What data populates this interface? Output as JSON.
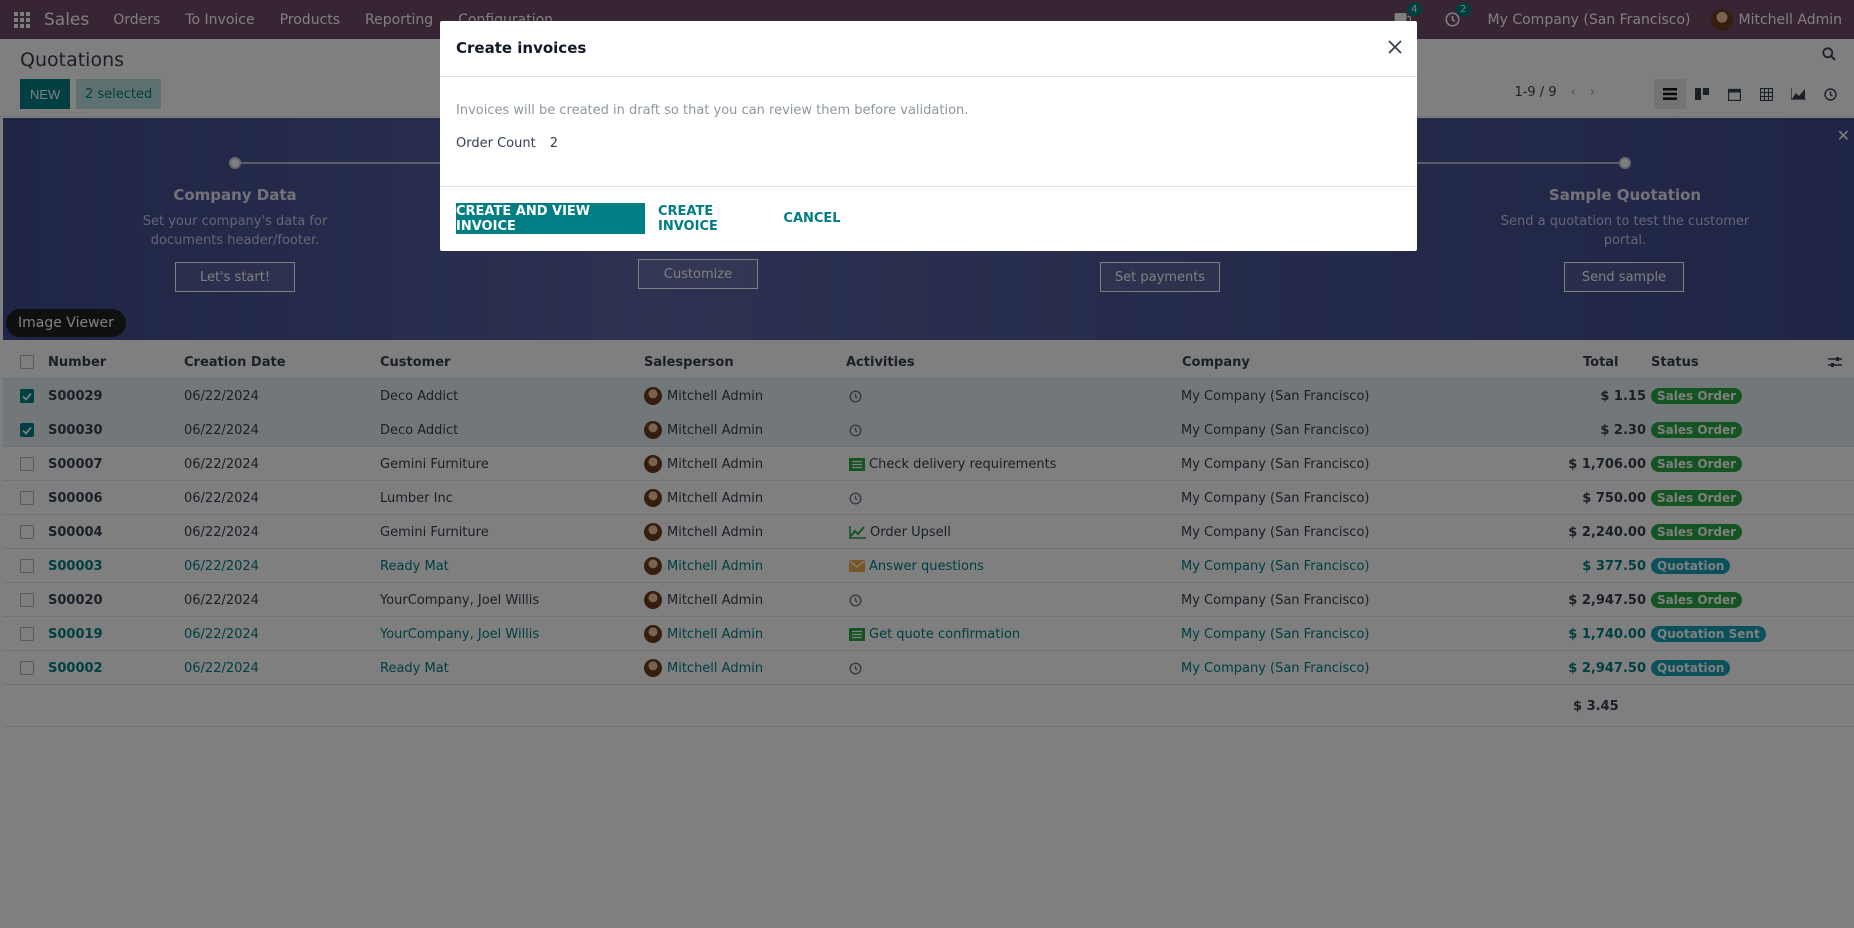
{
  "navbar": {
    "brand": "Sales",
    "menus": [
      "Orders",
      "To Invoice",
      "Products",
      "Reporting",
      "Configuration"
    ],
    "messages_count": "4",
    "activities_count": "2",
    "company": "My Company (San Francisco)",
    "user": "Mitchell Admin"
  },
  "control": {
    "title": "Quotations",
    "new_label": "NEW",
    "selected_label": "2 selected",
    "pager": "1-9 / 9"
  },
  "banner": {
    "steps": [
      {
        "title": "Company Data",
        "desc": "Set your company's data for documents header/footer.",
        "button": "Let's start!"
      },
      {
        "button": "Customize"
      },
      {
        "button": "Set payments"
      },
      {
        "title": "Sample Quotation",
        "desc": "Send a quotation to test the customer portal.",
        "button": "Send sample"
      }
    ],
    "tooltip": "Image Viewer"
  },
  "list": {
    "headers": {
      "number": "Number",
      "date": "Creation Date",
      "customer": "Customer",
      "salesperson": "Salesperson",
      "activities": "Activities",
      "company": "Company",
      "total": "Total",
      "status": "Status"
    },
    "rows": [
      {
        "number": "S00029",
        "date": "06/22/2024",
        "customer": "Deco Addict",
        "salesperson": "Mitchell Admin",
        "activity": "",
        "activity_icon": "clock-icon",
        "company": "My Company (San Francisco)",
        "total": "$ 1.15",
        "status": "Sales Order"
      },
      {
        "number": "S00030",
        "date": "06/22/2024",
        "customer": "Deco Addict",
        "salesperson": "Mitchell Admin",
        "activity": "",
        "activity_icon": "clock-icon",
        "company": "My Company (San Francisco)",
        "total": "$ 2.30",
        "status": "Sales Order"
      },
      {
        "number": "S00007",
        "date": "06/22/2024",
        "customer": "Gemini Furniture",
        "salesperson": "Mitchell Admin",
        "activity": "Check delivery requirements",
        "activity_icon": "list-icon",
        "company": "My Company (San Francisco)",
        "total": "$ 1,706.00",
        "status": "Sales Order"
      },
      {
        "number": "S00006",
        "date": "06/22/2024",
        "customer": "Lumber Inc",
        "salesperson": "Mitchell Admin",
        "activity": "",
        "activity_icon": "clock-icon",
        "company": "My Company (San Francisco)",
        "total": "$ 750.00",
        "status": "Sales Order"
      },
      {
        "number": "S00004",
        "date": "06/22/2024",
        "customer": "Gemini Furniture",
        "salesperson": "Mitchell Admin",
        "activity": "Order Upsell",
        "activity_icon": "chart-line-icon",
        "company": "My Company (San Francisco)",
        "total": "$ 2,240.00",
        "status": "Sales Order"
      },
      {
        "number": "S00003",
        "date": "06/22/2024",
        "customer": "Ready Mat",
        "salesperson": "Mitchell Admin",
        "activity": "Answer questions",
        "activity_icon": "envelope-icon",
        "company": "My Company (San Francisco)",
        "total": "$ 377.50",
        "status": "Quotation"
      },
      {
        "number": "S00020",
        "date": "06/22/2024",
        "customer": "YourCompany, Joel Willis",
        "salesperson": "Mitchell Admin",
        "activity": "",
        "activity_icon": "clock-icon",
        "company": "My Company (San Francisco)",
        "total": "$ 2,947.50",
        "status": "Sales Order"
      },
      {
        "number": "S00019",
        "date": "06/22/2024",
        "customer": "YourCompany, Joel Willis",
        "salesperson": "Mitchell Admin",
        "activity": "Get quote confirmation",
        "activity_icon": "list-icon",
        "company": "My Company (San Francisco)",
        "total": "$ 1,740.00",
        "status": "Quotation Sent"
      },
      {
        "number": "S00002",
        "date": "06/22/2024",
        "customer": "Ready Mat",
        "salesperson": "Mitchell Admin",
        "activity": "",
        "activity_icon": "clock-icon",
        "company": "My Company (San Francisco)",
        "total": "$ 2,947.50",
        "status": "Quotation"
      }
    ],
    "sum_total": "$ 3.45"
  },
  "modal": {
    "title": "Create invoices",
    "note": "Invoices will be created in draft so that you can review them before validation.",
    "field_label": "Order Count",
    "field_value": "2",
    "btn_primary": "CREATE AND VIEW INVOICE",
    "btn_create": "CREATE INVOICE",
    "btn_cancel": "CANCEL"
  },
  "colors": {
    "brand": "#714b67",
    "accent": "#017e84",
    "sales_order": "#28a745",
    "quotation": "#17a2b8"
  }
}
